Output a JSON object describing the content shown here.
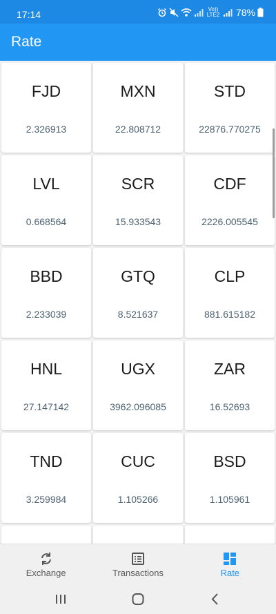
{
  "status_bar": {
    "time": "17:14",
    "signal_label": "Vo)) LTE2",
    "battery": "78%"
  },
  "app_bar": {
    "title": "Rate"
  },
  "rates": [
    {
      "code": "FJD",
      "value": "2.326913"
    },
    {
      "code": "MXN",
      "value": "22.808712"
    },
    {
      "code": "STD",
      "value": "22876.770275"
    },
    {
      "code": "LVL",
      "value": "0.668564"
    },
    {
      "code": "SCR",
      "value": "15.933543"
    },
    {
      "code": "CDF",
      "value": "2226.005545"
    },
    {
      "code": "BBD",
      "value": "2.233039"
    },
    {
      "code": "GTQ",
      "value": "8.521637"
    },
    {
      "code": "CLP",
      "value": "881.615182"
    },
    {
      "code": "HNL",
      "value": "27.147142"
    },
    {
      "code": "UGX",
      "value": "3962.096085"
    },
    {
      "code": "ZAR",
      "value": "16.52693"
    },
    {
      "code": "TND",
      "value": "3.259984"
    },
    {
      "code": "CUC",
      "value": "1.105266"
    },
    {
      "code": "BSD",
      "value": "1.105961"
    },
    {
      "code": "",
      "value": ""
    },
    {
      "code": "",
      "value": ""
    },
    {
      "code": "",
      "value": ""
    }
  ],
  "bottom_nav": {
    "items": [
      {
        "label": "Exchange",
        "icon": "sync-icon",
        "active": false
      },
      {
        "label": "Transactions",
        "icon": "list-icon",
        "active": false
      },
      {
        "label": "Rate",
        "icon": "dashboard-icon",
        "active": true
      }
    ]
  },
  "colors": {
    "app_bar": "#2196f3",
    "status_bar": "#1e88e5",
    "active_nav": "#2196f3",
    "rate_text": "#4d6270"
  }
}
